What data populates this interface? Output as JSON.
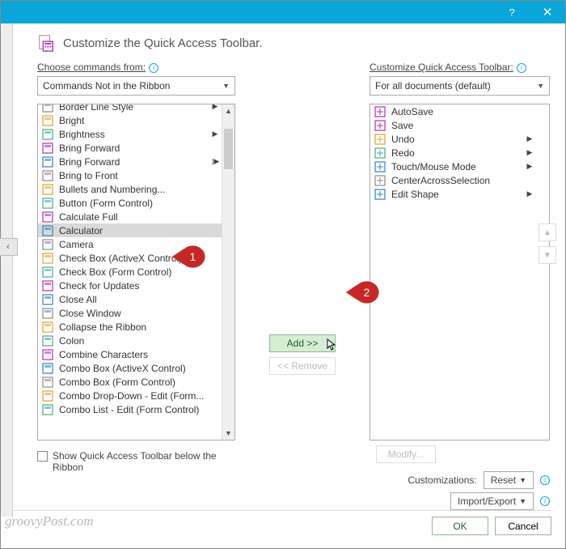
{
  "titlebar": {
    "help": "?",
    "close": "✕"
  },
  "heading": "Customize the Quick Access Toolbar.",
  "left": {
    "label": "Choose commands from:",
    "combo": "Commands Not in the Ribbon",
    "items": [
      {
        "label": "Border Line Style",
        "sub": "▶"
      },
      {
        "label": "Bright"
      },
      {
        "label": "Brightness",
        "sub": "▶"
      },
      {
        "label": "Bring Forward"
      },
      {
        "label": "Bring Forward",
        "sub": "|▶"
      },
      {
        "label": "Bring to Front"
      },
      {
        "label": "Bullets and Numbering..."
      },
      {
        "label": "Button (Form Control)"
      },
      {
        "label": "Calculate Full"
      },
      {
        "label": "Calculator",
        "selected": true
      },
      {
        "label": "Camera"
      },
      {
        "label": "Check Box (ActiveX Control)"
      },
      {
        "label": "Check Box (Form Control)"
      },
      {
        "label": "Check for Updates"
      },
      {
        "label": "Close All"
      },
      {
        "label": "Close Window"
      },
      {
        "label": "Collapse the Ribbon"
      },
      {
        "label": "Colon"
      },
      {
        "label": "Combine Characters"
      },
      {
        "label": "Combo Box (ActiveX Control)"
      },
      {
        "label": "Combo Box (Form Control)"
      },
      {
        "label": "Combo Drop-Down - Edit (Form..."
      },
      {
        "label": "Combo List - Edit (Form Control)"
      }
    ]
  },
  "mid": {
    "add": "Add >>",
    "remove": "<< Remove"
  },
  "right": {
    "label": "Customize Quick Access Toolbar:",
    "combo": "For all documents (default)",
    "items": [
      {
        "label": "AutoSave"
      },
      {
        "label": "Save"
      },
      {
        "label": "Undo",
        "sub": "▶"
      },
      {
        "label": "Redo",
        "sub": "▶"
      },
      {
        "label": "Touch/Mouse Mode",
        "sub": "▶"
      },
      {
        "label": "CenterAcrossSelection"
      },
      {
        "label": "Edit Shape",
        "sub": "▶"
      }
    ],
    "modify": "Modify...",
    "cust_label": "Customizations:",
    "reset": "Reset",
    "import": "Import/Export"
  },
  "show_label": "Show Quick Access Toolbar below the Ribbon",
  "footer": {
    "ok": "OK",
    "cancel": "Cancel"
  },
  "watermark": "groovyPost.com",
  "badges": {
    "b1": "1",
    "b2": "2"
  },
  "paging": "‹"
}
